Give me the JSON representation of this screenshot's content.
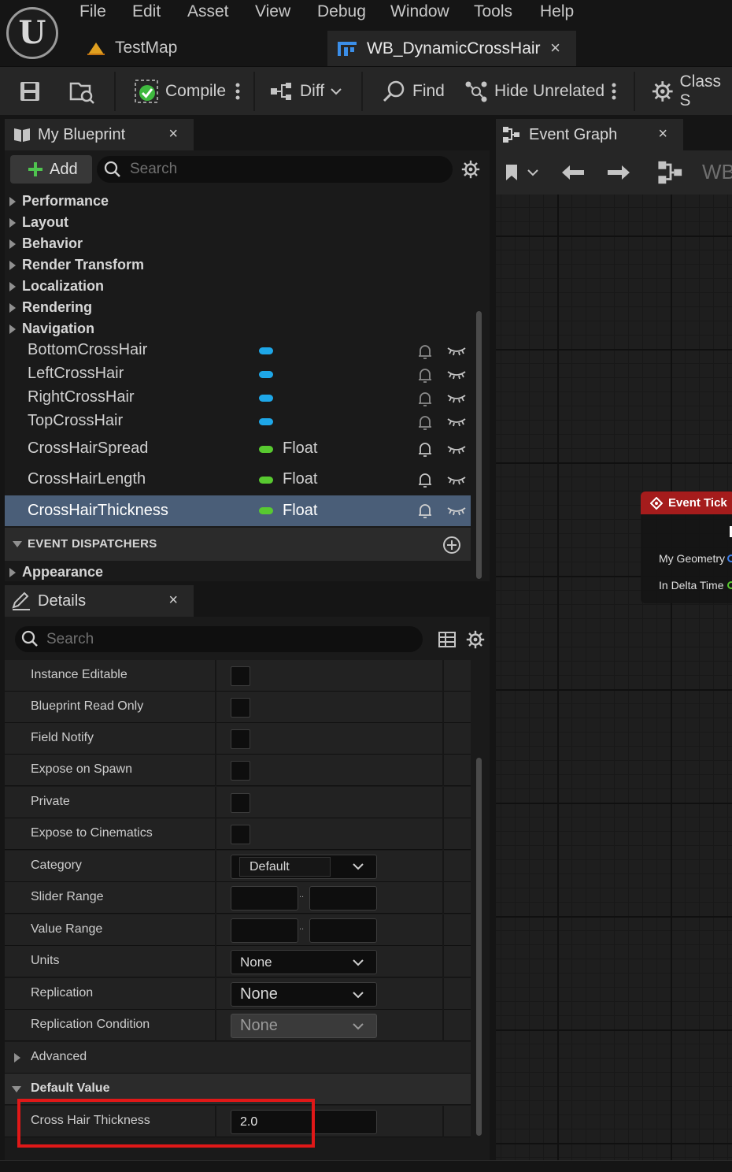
{
  "menu": [
    "File",
    "Edit",
    "Asset",
    "View",
    "Debug",
    "Window",
    "Tools",
    "Help"
  ],
  "tabs": {
    "level": "TestMap",
    "asset": "WB_DynamicCrossHair",
    "close_glyph": "×"
  },
  "toolbar": {
    "compile": "Compile",
    "diff": "Diff",
    "find": "Find",
    "hide_unrelated": "Hide Unrelated",
    "class_settings": "Class S"
  },
  "my_blueprint": {
    "title": "My Blueprint",
    "add_label": "Add",
    "search_placeholder": "Search",
    "categories": [
      "Performance",
      "Layout",
      "Behavior",
      "Render Transform",
      "Localization",
      "Rendering",
      "Navigation"
    ],
    "variables": [
      {
        "name": "BottomCrossHair",
        "type": "",
        "pill_color": "#1ea7e8"
      },
      {
        "name": "LeftCrossHair",
        "type": "",
        "pill_color": "#1ea7e8"
      },
      {
        "name": "RightCrossHair",
        "type": "",
        "pill_color": "#1ea7e8"
      },
      {
        "name": "TopCrossHair",
        "type": "",
        "pill_color": "#1ea7e8"
      },
      {
        "name": "CrossHairSpread",
        "type": "Float",
        "pill_color": "#58c930"
      },
      {
        "name": "CrossHairLength",
        "type": "Float",
        "pill_color": "#58c930"
      },
      {
        "name": "CrossHairThickness",
        "type": "Float",
        "pill_color": "#58c930",
        "selected": true
      }
    ],
    "event_dispatchers": "EVENT DISPATCHERS",
    "appearance": "Appearance"
  },
  "details": {
    "title": "Details",
    "search_placeholder": "Search",
    "properties": {
      "instance_editable": "Instance Editable",
      "blueprint_read_only": "Blueprint Read Only",
      "field_notify": "Field Notify",
      "expose_on_spawn": "Expose on Spawn",
      "private": "Private",
      "expose_to_cinematics": "Expose to Cinematics",
      "category": "Category",
      "category_value": "Default",
      "slider_range": "Slider Range",
      "value_range": "Value Range",
      "range_separator": "..",
      "units": "Units",
      "units_value": "None",
      "replication": "Replication",
      "replication_value": "None",
      "replication_condition": "Replication Condition",
      "replication_condition_value": "None"
    },
    "advanced": "Advanced",
    "default_value_section": "Default Value",
    "default_value_label": "Cross Hair Thickness",
    "default_value": "2.0"
  },
  "graph": {
    "tab_title": "Event Graph",
    "breadcrumb": "WB",
    "node_title": "Event Tick",
    "pins": [
      "My Geometry",
      "In Delta Time"
    ]
  },
  "colors": {
    "accent_highlight": "#e01818",
    "selected_row": "#4a5e78",
    "node_header": "#a51c1c",
    "compile_ok": "#3fb93f"
  }
}
